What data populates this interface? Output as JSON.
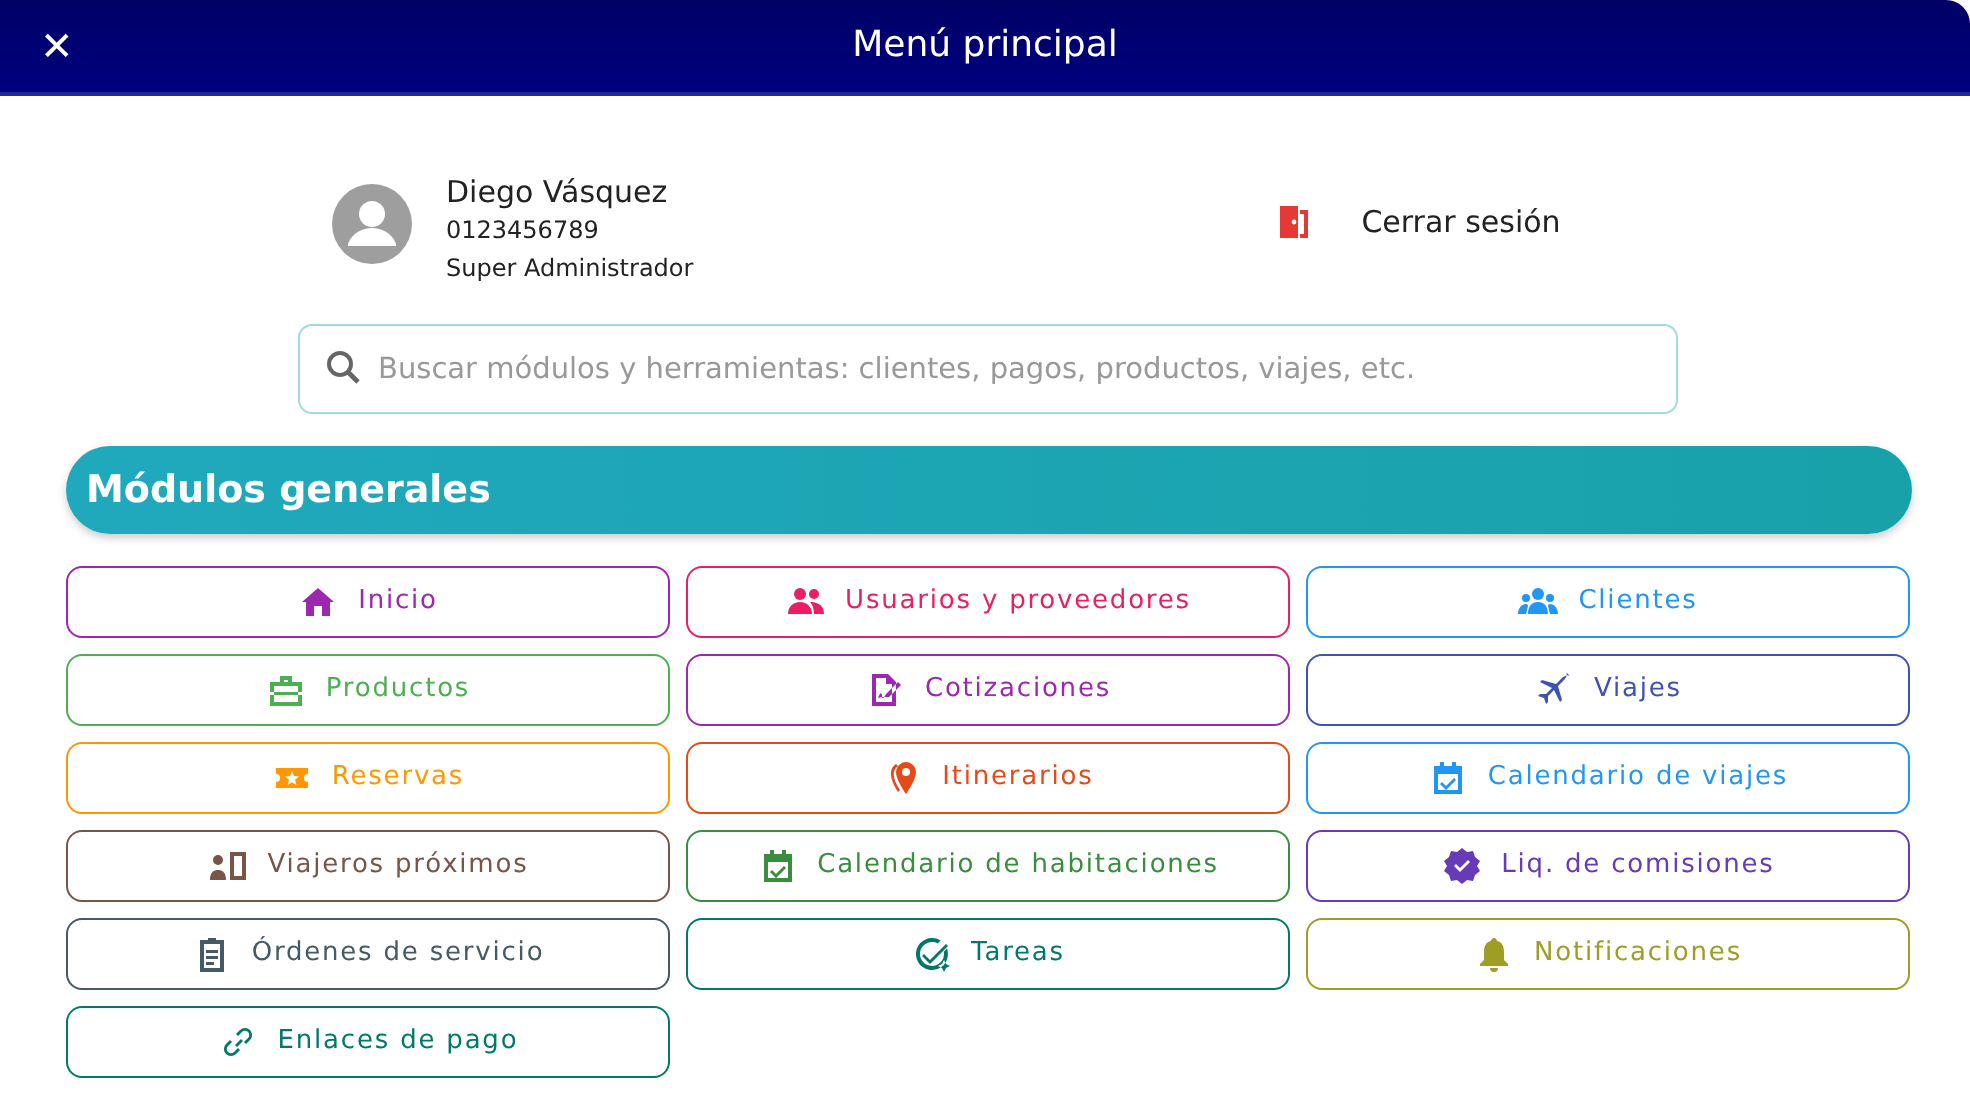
{
  "window": {
    "title": "Menú principal",
    "close_label": "✕"
  },
  "user": {
    "name": "Diego Vásquez",
    "phone": "0123456789",
    "role": "Super Administrador"
  },
  "logout": {
    "label": "Cerrar sesión"
  },
  "search": {
    "placeholder": "Buscar módulos y herramientas: clientes, pagos, productos, viajes, etc."
  },
  "section": {
    "title": "Módulos generales"
  },
  "modules": [
    {
      "label": "Inicio",
      "color": "#9c27b0"
    },
    {
      "label": "Usuarios y proveedores",
      "color": "#e91e63"
    },
    {
      "label": "Clientes",
      "color": "#2196f3"
    },
    {
      "label": "Productos",
      "color": "#4caf50"
    },
    {
      "label": "Cotizaciones",
      "color": "#9c27b0"
    },
    {
      "label": "Viajes",
      "color": "#3f51b5"
    },
    {
      "label": "Reservas",
      "color": "#ff9800"
    },
    {
      "label": "Itinerarios",
      "color": "#e64a19"
    },
    {
      "label": "Calendario de viajes",
      "color": "#2196f3"
    },
    {
      "label": "Viajeros próximos",
      "color": "#795548"
    },
    {
      "label": "Calendario de habitaciones",
      "color": "#388e3c"
    },
    {
      "label": "Liq. de comisiones",
      "color": "#673ab7"
    },
    {
      "label": "Órdenes de servicio",
      "color": "#455a64"
    },
    {
      "label": "Tareas",
      "color": "#00796b"
    },
    {
      "label": "Notificaciones",
      "color": "#9e9d24"
    },
    {
      "label": "Enlaces de pago",
      "color": "#00796b"
    }
  ]
}
